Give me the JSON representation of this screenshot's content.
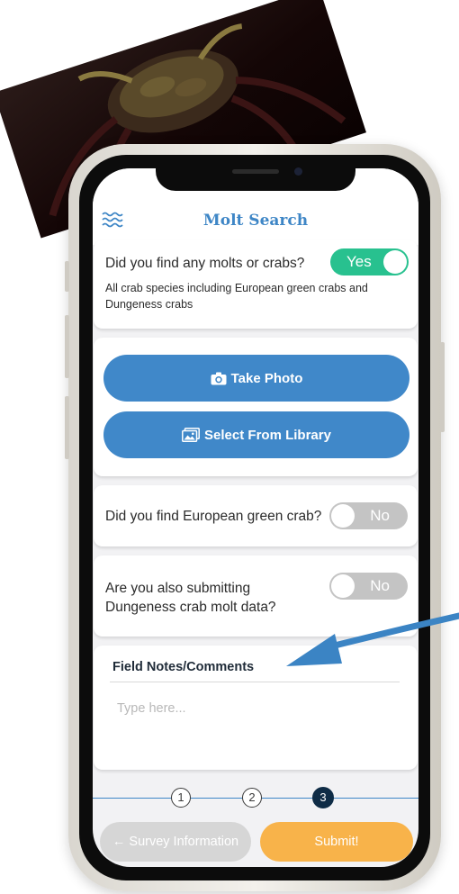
{
  "app": {
    "title": "Molt Search",
    "menu_icon": "waves-icon"
  },
  "colors": {
    "brand_blue": "#3e86c6",
    "toggle_on": "#28c18f",
    "toggle_off": "#c4c4c4",
    "submit": "#f8b34a",
    "back": "#d6d6d6",
    "step_active": "#0f2c46",
    "annotation_arrow": "#3b84c4"
  },
  "questions": {
    "molts": {
      "label": "Did you find any molts or crabs?",
      "toggle": "Yes",
      "is_on": true,
      "note": "All crab species including European green crabs and Dungeness crabs"
    },
    "green_crab": {
      "label": "Did you find European green crab?",
      "toggle": "No",
      "is_on": false
    },
    "dungeness": {
      "label": "Are you also submitting Dungeness crab molt data?",
      "toggle": "No",
      "is_on": false
    }
  },
  "photo": {
    "take_label": "Take Photo",
    "take_icon": "camera-icon",
    "library_label": "Select From Library",
    "library_icon": "gallery-icon"
  },
  "notes": {
    "title": "Field Notes/Comments",
    "placeholder": "Type here...",
    "value": ""
  },
  "stepper": {
    "steps": [
      "1",
      "2",
      "3"
    ],
    "current": 3
  },
  "footer": {
    "back_label": "← Survey Information",
    "submit_label": "Submit!"
  }
}
